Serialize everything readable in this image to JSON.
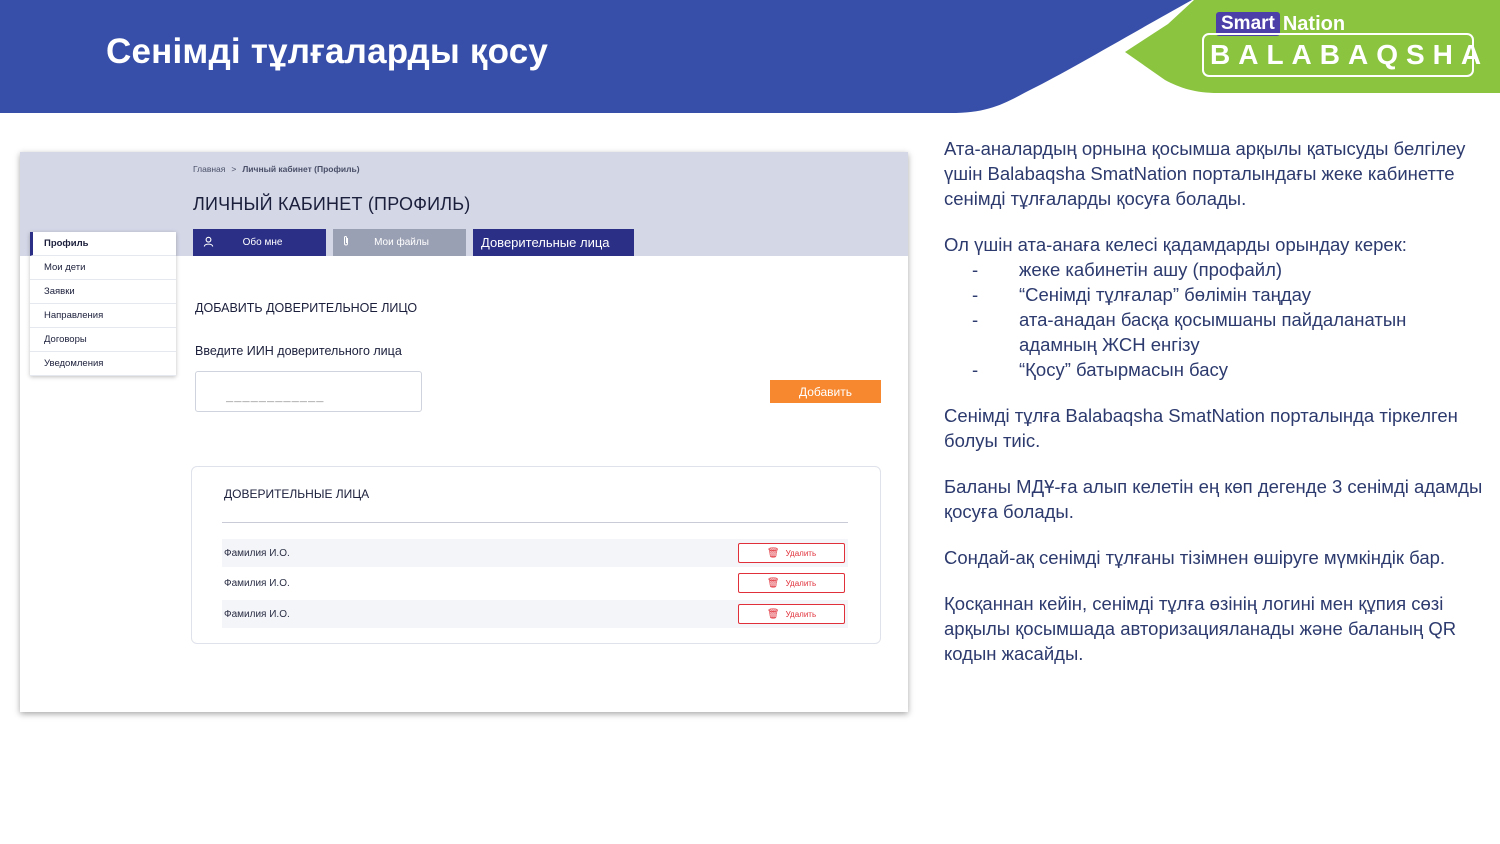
{
  "slide": {
    "title": "Сенімді тұлғаларды қосу",
    "colors": {
      "header_blue": "#374fa9",
      "accent_green": "#8bc43f",
      "text": "#2c3a6e"
    }
  },
  "logo": {
    "smart": "Smart",
    "nation": "Nation",
    "product": "BALABAQSHA"
  },
  "screenshot": {
    "breadcrumb": {
      "home": "Главная",
      "separator": ">",
      "current": "Личный кабинет (Профиль)"
    },
    "page_title": "ЛИЧНЫЙ КАБИНЕТ (ПРОФИЛЬ)",
    "tabs": [
      {
        "label": "Обо мне",
        "icon": "user-icon"
      },
      {
        "label": "Мои файлы",
        "icon": "paperclip-icon"
      },
      {
        "label": "Доверительные лица"
      }
    ],
    "sidebar": [
      "Профиль",
      "Мои дети",
      "Заявки",
      "Направления",
      "Договоры",
      "Уведомления"
    ],
    "add_section": {
      "title": "ДОБАВИТЬ ДОВЕРИТЕЛЬНОЕ ЛИЦО",
      "iin_label": "Введите ИИН доверительного лица",
      "iin_placeholder": "____________",
      "add_button": "Добавить"
    },
    "trusted": {
      "title": "ДОВЕРИТЕЛЬНЫЕ ЛИЦА",
      "rows": [
        {
          "name": "Фамилия И.О.",
          "action": "Удалить"
        },
        {
          "name": "Фамилия И.О.",
          "action": "Удалить"
        },
        {
          "name": "Фамилия И.О.",
          "action": "Удалить"
        }
      ]
    },
    "colors": {
      "dark_blue": "#2b2f86",
      "orange": "#f7882f",
      "red": "#e0303a"
    }
  },
  "text": {
    "p1": "Ата-аналардың орнына қосымша арқылы қатысуды белгілеу үшін Balabaqsha SmatNation порталындағы жеке кабинетте сенімді тұлғаларды қосуға болады.",
    "p2": "Ол үшін ата-анаға келесі қадамдарды орындау керек:",
    "steps": [
      "жеке кабинетін ашу (профайл)",
      "“Сенімді тұлғалар” бөлімін таңдау",
      "ата-анадан басқа қосымшаны пайдаланатын адамның ЖСН енгізу",
      "“Қосу” батырмасын басу"
    ],
    "p3": "Сенімді тұлға Balabaqsha SmatNation порталында тіркелген болуы тиіс.",
    "p4": "Баланы МДҰ-ға алып келетін ең көп дегенде 3 сенімді адамды қосуға болады.",
    "p5": "Сондай-ақ сенімді тұлғаны тізімнен өшіруге мүмкіндік бар.",
    "p6": "Қосқаннан кейін, сенімді тұлға өзінің логині мен құпия сөзі арқылы қосымшада авторизацияланады және баланың QR кодын жасайды."
  }
}
